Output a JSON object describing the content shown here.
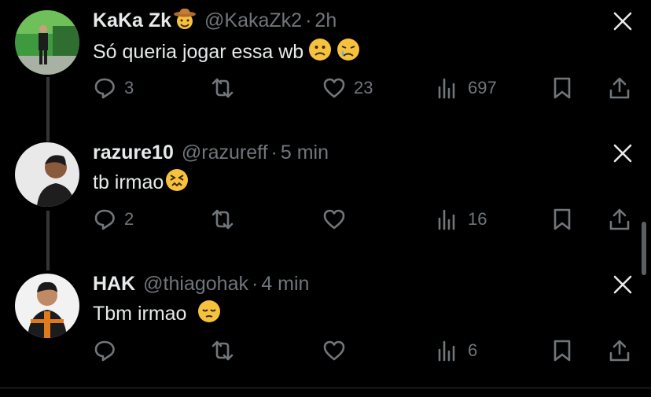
{
  "tweets": [
    {
      "name": "KaKa Zk",
      "name_emoji": "cowboy-hat-face",
      "handle": "@KakaZk2",
      "separator": "·",
      "time": "2h",
      "text": "Só queria jogar essa wb",
      "text_emojis": [
        "slightly-frowning-face",
        "crying-face"
      ],
      "replies": "3",
      "reposts": "",
      "likes": "23",
      "views": "697"
    },
    {
      "name": "razure10",
      "handle": "@razureff",
      "separator": "·",
      "time": "5 min",
      "text": "tb irmao",
      "text_emojis": [
        "confounded-face"
      ],
      "replies": "2",
      "reposts": "",
      "likes": "",
      "views": "16"
    },
    {
      "name": "HAK",
      "handle": "@thiagohak",
      "separator": "·",
      "time": "4 min",
      "text": "Tbm irmao",
      "text_emojis": [
        "pensive-face"
      ],
      "replies": "",
      "reposts": "",
      "likes": "",
      "views": "6"
    }
  ],
  "colors": {
    "background": "#000000",
    "text_primary": "#e7e9ea",
    "text_secondary": "#71767b",
    "thread_line": "#333639"
  }
}
